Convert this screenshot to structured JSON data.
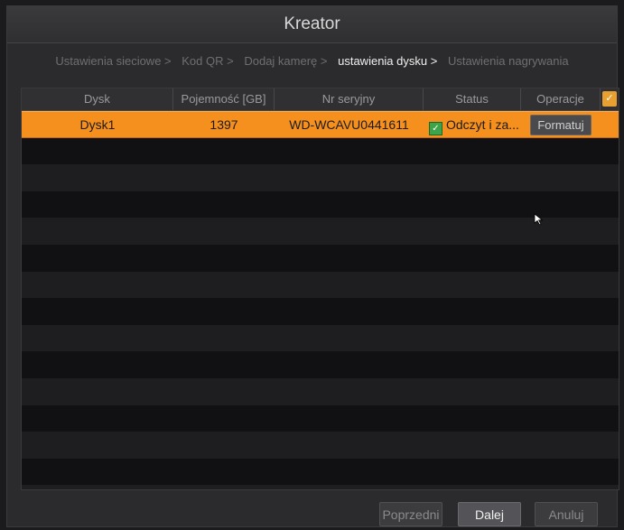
{
  "window": {
    "title": "Kreator"
  },
  "steps": [
    {
      "label": "Ustawienia sieciowe >",
      "active": false
    },
    {
      "label": "Kod QR >",
      "active": false
    },
    {
      "label": "Dodaj kamerę >",
      "active": false
    },
    {
      "label": "ustawienia dysku >",
      "active": true
    },
    {
      "label": "Ustawienia nagrywania",
      "active": false
    }
  ],
  "table": {
    "columns": [
      "Dysk",
      "Pojemność [GB]",
      "Nr seryjny",
      "Status",
      "Operacje"
    ],
    "rows": [
      {
        "disk": "Dysk1",
        "capacity": "1397",
        "serial": "WD-WCAVU0441611",
        "status": "Odczyt i za...",
        "action": "Formatuj"
      }
    ]
  },
  "buttons": {
    "prev": "Poprzedni",
    "next": "Dalej",
    "cancel": "Anuluj"
  },
  "icons": {
    "status": "status-ok-icon",
    "check": "check-icon",
    "cursor": "mouse-cursor-icon"
  },
  "colors": {
    "selected_row": "#f5901e",
    "accent": "#e8a030"
  }
}
